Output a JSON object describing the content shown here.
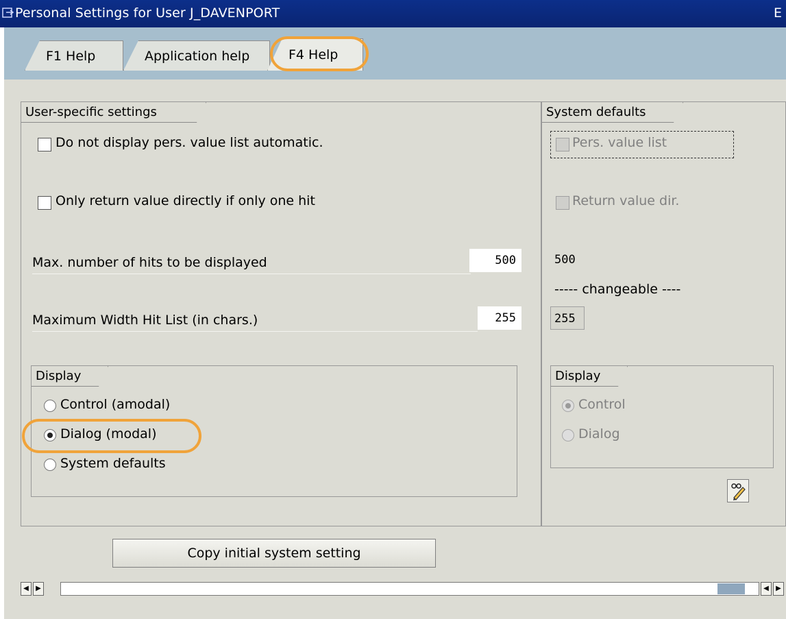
{
  "window": {
    "title": "Personal Settings for User J_DAVENPORT",
    "right_glyph": "E"
  },
  "tabs": [
    {
      "label": "F1 Help",
      "active": false
    },
    {
      "label": "Application help",
      "active": false
    },
    {
      "label": "F4 Help",
      "active": true
    }
  ],
  "user_settings": {
    "title": "User-specific settings",
    "checkbox_no_display": {
      "label": "Do not display pers. value list automatic.",
      "checked": false
    },
    "checkbox_return_direct": {
      "label": "Only return value directly if only one hit",
      "checked": false
    },
    "max_hits": {
      "label": "Max. number of hits to be displayed",
      "value": "500"
    },
    "max_width": {
      "label": "Maximum Width Hit List (in chars.)",
      "value": "255"
    },
    "display": {
      "title": "Display",
      "options": [
        {
          "label": "Control (amodal)",
          "selected": false
        },
        {
          "label": "Dialog (modal)",
          "selected": true
        },
        {
          "label": "System defaults",
          "selected": false
        }
      ]
    }
  },
  "system_defaults": {
    "title": "System defaults",
    "pers_value_list": {
      "label": "Pers. value list",
      "checked": false
    },
    "return_value_dir": {
      "label": "Return value dir.",
      "checked": false
    },
    "max_hits_value": "500",
    "changeable_note": "----- changeable ----",
    "max_width_value": "255",
    "display": {
      "title": "Display",
      "options": [
        {
          "label": "Control",
          "selected": true
        },
        {
          "label": "Dialog",
          "selected": false
        }
      ]
    },
    "edit_icon": "pencil-glasses-icon"
  },
  "buttons": {
    "copy_initial": "Copy initial system setting"
  },
  "colors": {
    "titlebar": "#0a2472",
    "highlight": "#f0a33a",
    "tabstrip": "#a6becd",
    "background": "#dcdcd4"
  }
}
